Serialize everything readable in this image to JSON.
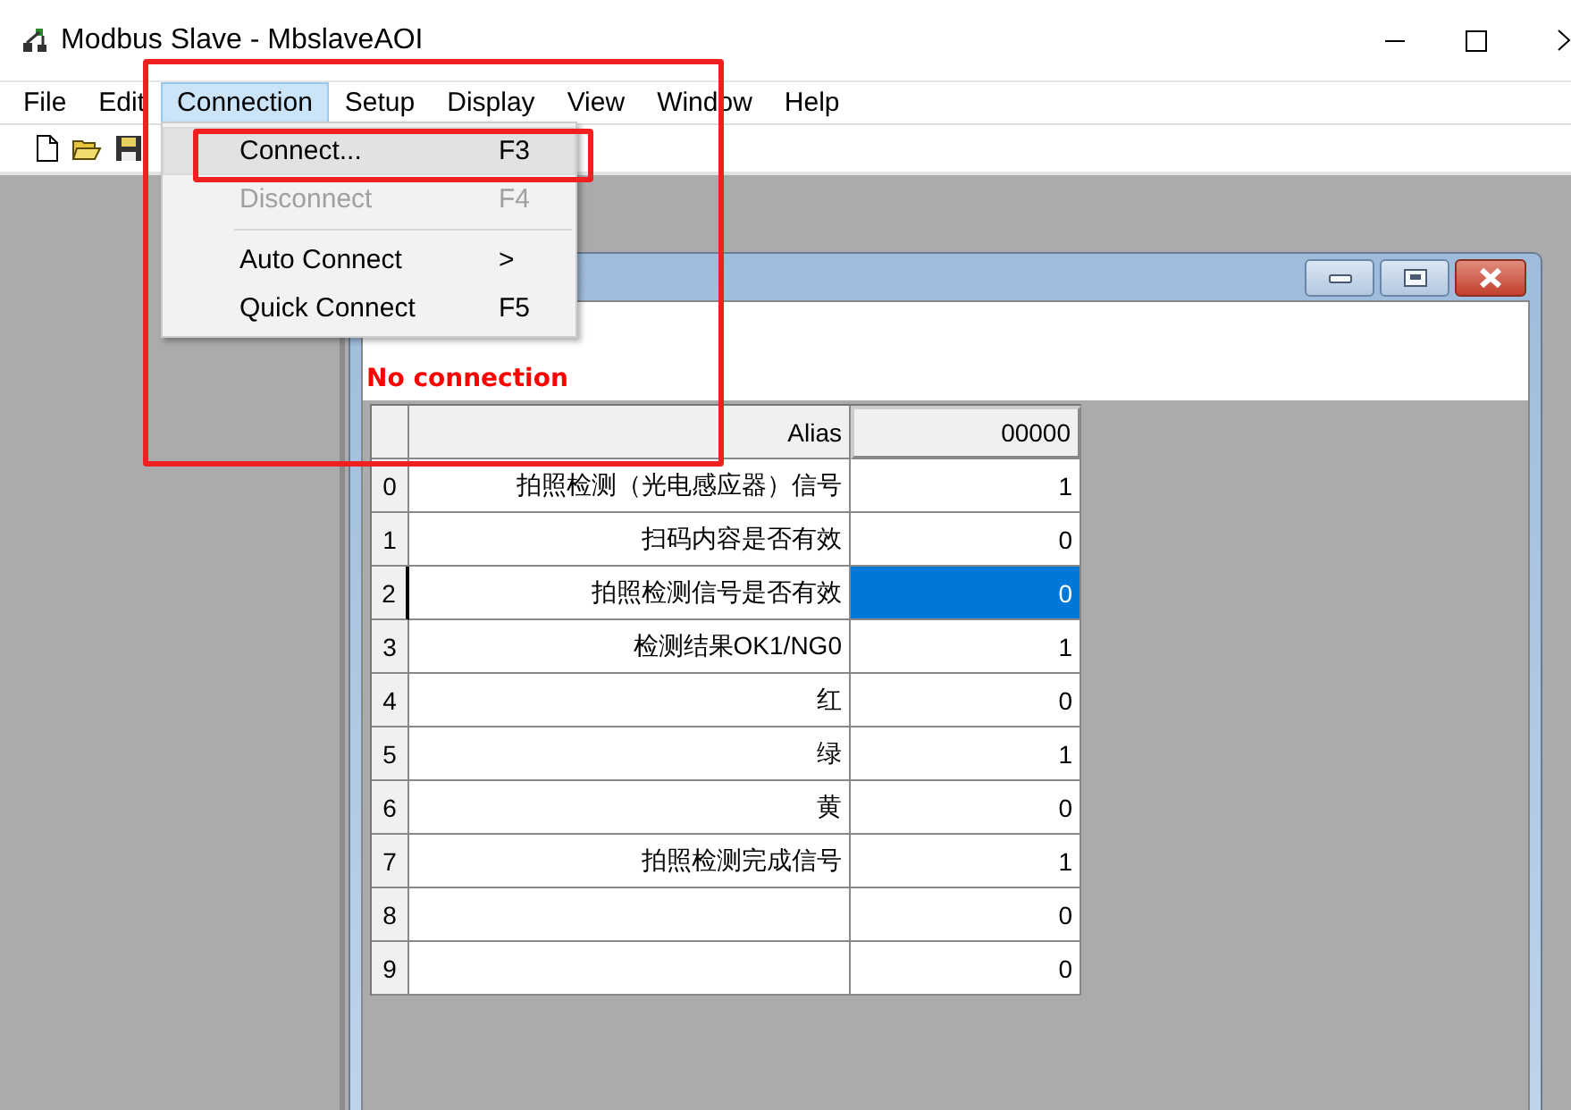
{
  "window": {
    "title": "Modbus Slave - MbslaveAOI"
  },
  "menu": [
    {
      "label": "File",
      "selected": false
    },
    {
      "label": "Edit",
      "selected": false
    },
    {
      "label": "Connection",
      "selected": true
    },
    {
      "label": "Setup",
      "selected": false
    },
    {
      "label": "Display",
      "selected": false
    },
    {
      "label": "View",
      "selected": false
    },
    {
      "label": "Window",
      "selected": false
    },
    {
      "label": "Help",
      "selected": false
    }
  ],
  "dropdown": [
    {
      "kind": "item",
      "label": "Connect...",
      "shortcut": "F3",
      "selected": true,
      "disabled": false
    },
    {
      "kind": "item",
      "label": "Disconnect",
      "shortcut": "F4",
      "selected": false,
      "disabled": true
    },
    {
      "kind": "separator"
    },
    {
      "kind": "submenu",
      "label": "Auto Connect",
      "arrow": ">",
      "selected": false,
      "disabled": false
    },
    {
      "kind": "item",
      "label": "Quick Connect",
      "shortcut": "F5",
      "selected": false,
      "disabled": false
    }
  ],
  "child": {
    "status": "No connection",
    "columns": [
      "Alias",
      "00000"
    ],
    "rows": [
      {
        "num": "0",
        "alias": "拍照检测（光电感应器）信号",
        "value": "1",
        "selected": false
      },
      {
        "num": "1",
        "alias": "扫码内容是否有效",
        "value": "0",
        "selected": false
      },
      {
        "num": "2",
        "alias": "拍照检测信号是否有效",
        "value": "0",
        "selected": true
      },
      {
        "num": "3",
        "alias": "检测结果OK1/NG0",
        "value": "1",
        "selected": false
      },
      {
        "num": "4",
        "alias": "红",
        "value": "0",
        "selected": false
      },
      {
        "num": "5",
        "alias": "绿",
        "value": "1",
        "selected": false
      },
      {
        "num": "6",
        "alias": "黄",
        "value": "0",
        "selected": false
      },
      {
        "num": "7",
        "alias": "拍照检测完成信号",
        "value": "1",
        "selected": false
      },
      {
        "num": "8",
        "alias": "",
        "value": "0",
        "selected": false
      },
      {
        "num": "9",
        "alias": "",
        "value": "0",
        "selected": false
      }
    ]
  }
}
